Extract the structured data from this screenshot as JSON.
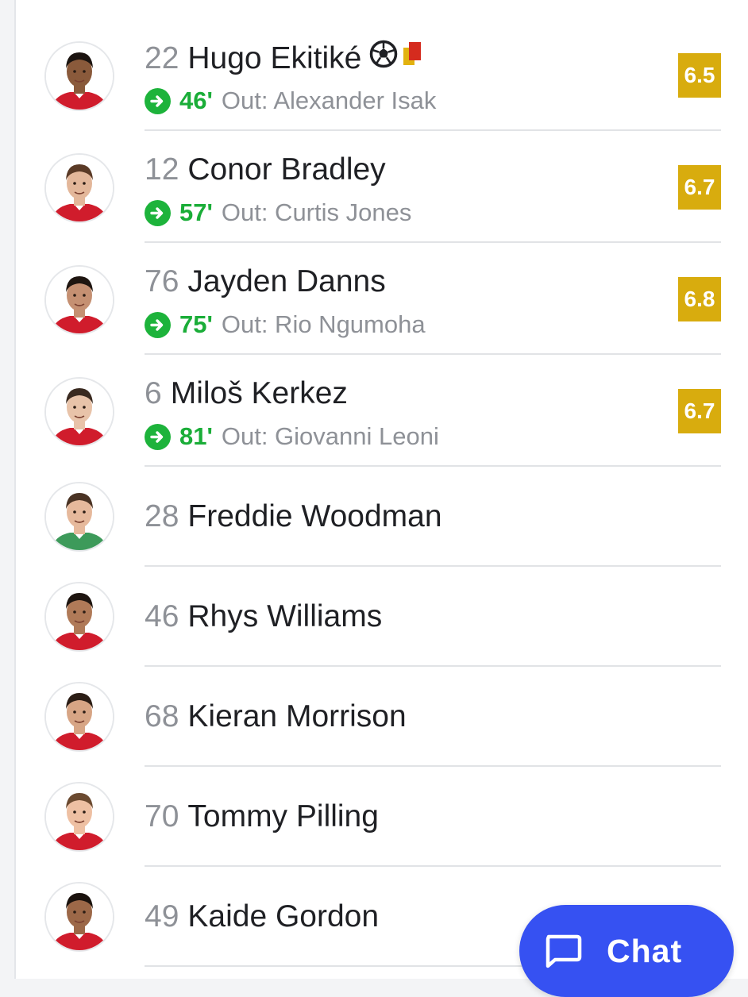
{
  "players": [
    {
      "number": "22",
      "name": "Hugo Ekitiké",
      "has_goal_icon": true,
      "has_card_icon": true,
      "sub": {
        "minute": "46'",
        "out": "Out: Alexander Isak"
      },
      "rating": "6.5",
      "kit": "red",
      "skin": "#8a5a3b",
      "hair": "#1b1410"
    },
    {
      "number": "12",
      "name": "Conor Bradley",
      "sub": {
        "minute": "57'",
        "out": "Out: Curtis Jones"
      },
      "rating": "6.7",
      "kit": "red",
      "skin": "#e3b79a",
      "hair": "#5a3a26"
    },
    {
      "number": "76",
      "name": "Jayden Danns",
      "sub": {
        "minute": "75'",
        "out": "Out: Rio Ngumoha"
      },
      "rating": "6.8",
      "kit": "red",
      "skin": "#c59072",
      "hair": "#1e1510"
    },
    {
      "number": "6",
      "name": "Miloš Kerkez",
      "sub": {
        "minute": "81'",
        "out": "Out: Giovanni Leoni"
      },
      "rating": "6.7",
      "kit": "red",
      "skin": "#e8c3a9",
      "hair": "#3a2a20"
    },
    {
      "number": "28",
      "name": "Freddie Woodman",
      "kit": "green",
      "skin": "#e6b99c",
      "hair": "#4a3324"
    },
    {
      "number": "46",
      "name": "Rhys Williams",
      "kit": "red",
      "skin": "#b07a58",
      "hair": "#1e1510"
    },
    {
      "number": "68",
      "name": "Kieran Morrison",
      "kit": "red",
      "skin": "#d7a585",
      "hair": "#2b1d15"
    },
    {
      "number": "70",
      "name": "Tommy Pilling",
      "kit": "red",
      "skin": "#eec0a3",
      "hair": "#6b4a30"
    },
    {
      "number": "49",
      "name": "Kaide Gordon",
      "kit": "red",
      "skin": "#9c6848",
      "hair": "#1a120d"
    }
  ],
  "icons": {
    "goal": "soccer-ball-icon",
    "card": "red-card-icon",
    "sub": "substitution-arrow-icon",
    "chat": "chat-bubble-icon"
  },
  "chat": {
    "label": "Chat"
  },
  "colors": {
    "rating_bg": "#d8ac0e",
    "sub_green": "#1aad38",
    "chat_blue": "#3651f2",
    "kit_red": "#d01c2c",
    "kit_green": "#3d9a5a"
  }
}
